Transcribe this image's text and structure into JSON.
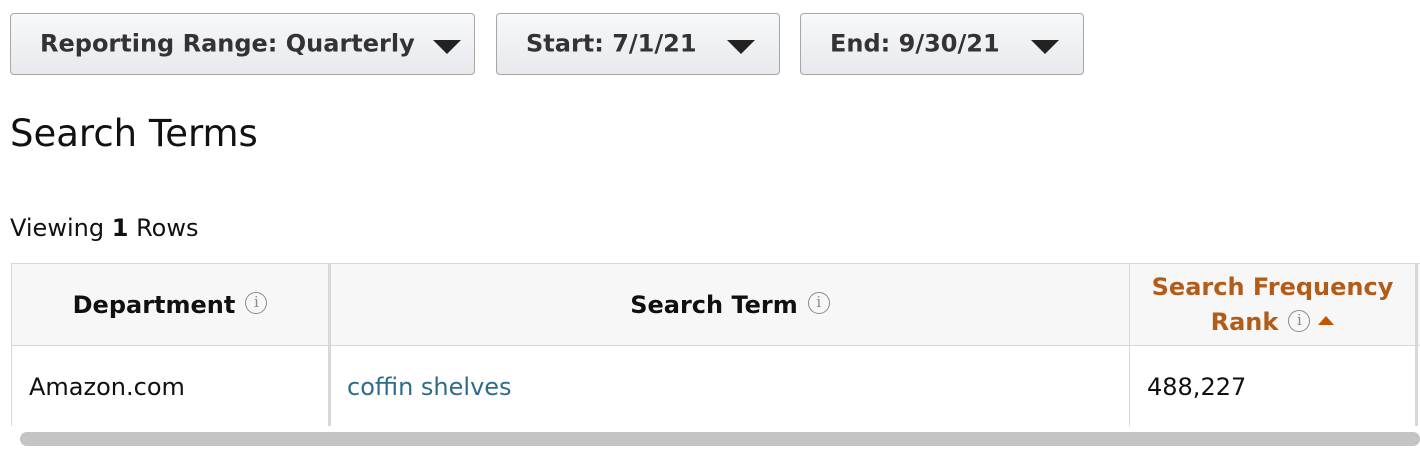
{
  "filters": {
    "range_label": "Reporting Range: Quarterly",
    "start_label": "Start: 7/1/21",
    "end_label": "End: 9/30/21"
  },
  "page": {
    "title": "Search Terms",
    "viewing_prefix": "Viewing",
    "viewing_count": "1",
    "viewing_suffix": "Rows"
  },
  "table": {
    "columns": [
      {
        "label": "Department"
      },
      {
        "label": "Search Term"
      },
      {
        "label_line1": "Search Frequency",
        "label_line2": "Rank",
        "sorted": "ascending"
      }
    ],
    "rows": [
      {
        "department": "Amazon.com",
        "search_term": "coffin shelves",
        "rank": "488,227"
      }
    ]
  },
  "icons": {
    "info": "info-circle-icon",
    "dropdown": "caret-down-icon",
    "sort": "sort-ascending-icon"
  },
  "colors": {
    "sorted_header": "#b35c1a",
    "link": "#2e6c8a"
  }
}
